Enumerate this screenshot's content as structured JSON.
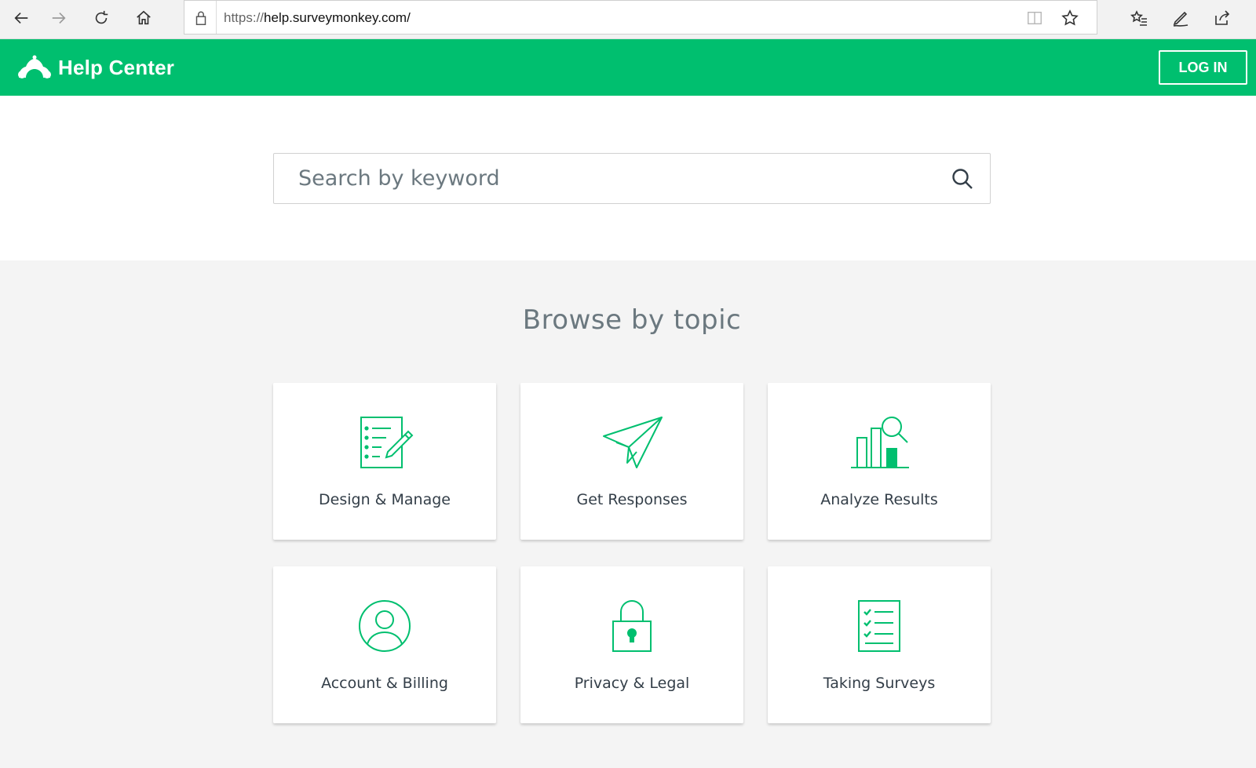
{
  "browser": {
    "url_prefix": "https://",
    "url_host": "help.surveymonkey.com/",
    "icons": [
      "back-arrow-icon",
      "forward-arrow-icon",
      "refresh-icon",
      "home-icon",
      "lock-icon",
      "reading-view-icon",
      "star-icon",
      "favorites-list-icon",
      "pen-icon",
      "share-icon"
    ]
  },
  "header": {
    "logo_text": "Help Center",
    "login_label": "LOG IN",
    "brand_color": "#00bf6f"
  },
  "search": {
    "placeholder": "Search by keyword"
  },
  "browse": {
    "title": "Browse by topic",
    "topics": [
      {
        "label": "Design & Manage",
        "icon": "checklist-pencil-icon"
      },
      {
        "label": "Get Responses",
        "icon": "paper-plane-icon"
      },
      {
        "label": "Analyze Results",
        "icon": "bar-chart-magnifier-icon"
      },
      {
        "label": "Account & Billing",
        "icon": "user-circle-icon"
      },
      {
        "label": "Privacy & Legal",
        "icon": "padlock-icon"
      },
      {
        "label": "Taking Surveys",
        "icon": "checklist-icon"
      }
    ]
  }
}
